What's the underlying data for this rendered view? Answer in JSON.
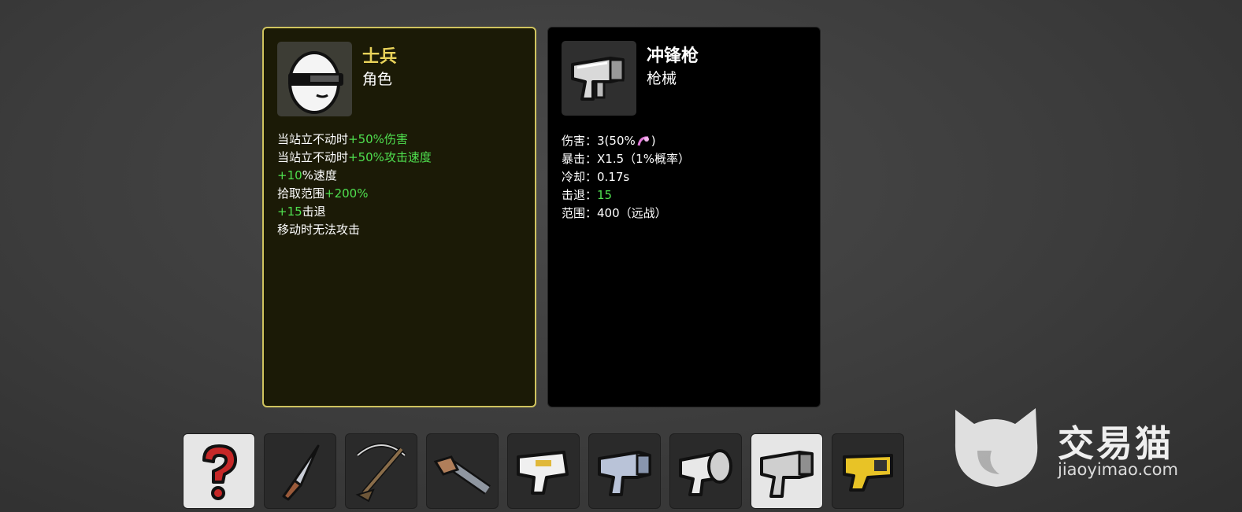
{
  "character_card": {
    "name": "士兵",
    "category": "角色",
    "portrait_icon": "soldier-egg-icon",
    "stats": [
      {
        "prefix": "当站立不动时",
        "highlight": "+50%伤害",
        "suffix": ""
      },
      {
        "prefix": "当站立不动时",
        "highlight": "+50%攻击速度",
        "suffix": ""
      },
      {
        "prefix": "",
        "highlight": "+10",
        "suffix": "%速度"
      },
      {
        "prefix": "拾取范围",
        "highlight": "+200%",
        "suffix": ""
      },
      {
        "prefix": "",
        "highlight": "+15",
        "suffix": "击退"
      },
      {
        "prefix": "移动时无法攻击",
        "highlight": "",
        "suffix": ""
      }
    ]
  },
  "weapon_card": {
    "name": "冲锋枪",
    "category": "枪械",
    "portrait_icon": "smg-icon",
    "stats": {
      "damage_label": "伤害：",
      "damage_value": "3(50%",
      "damage_close": ")",
      "crit_label": "暴击：",
      "crit_value": "X1.5（1%概率）",
      "cooldown_label": "冷却：",
      "cooldown_value": "0.17s",
      "knockback_label": "击退：",
      "knockback_value": "15",
      "range_label": "范围：",
      "range_value": "400（远战）"
    }
  },
  "hotbar": [
    {
      "icon": "question-mark-icon",
      "selected": true
    },
    {
      "icon": "knife-icon",
      "selected": false
    },
    {
      "icon": "crossbow-icon",
      "selected": false
    },
    {
      "icon": "double-barrel-shotgun-icon",
      "selected": false
    },
    {
      "icon": "pistol-icon",
      "selected": false
    },
    {
      "icon": "smg-blue-icon",
      "selected": false
    },
    {
      "icon": "minigun-icon",
      "selected": false
    },
    {
      "icon": "smg-icon",
      "selected": true
    },
    {
      "icon": "taser-icon",
      "selected": false
    }
  ],
  "watermark": {
    "text_cn": "交易猫",
    "text_url": "jiaoyimao.com"
  },
  "colors": {
    "highlight_green": "#4fe04f",
    "char_title_yellow": "#e8d25a",
    "char_border": "#cfc35e"
  }
}
